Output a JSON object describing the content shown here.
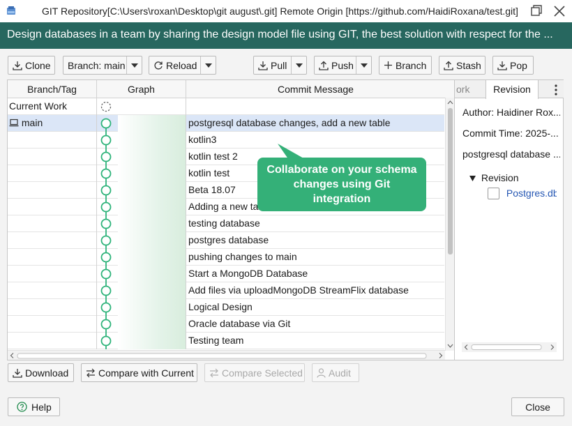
{
  "window": {
    "title": "GIT Repository[C:\\Users\\roxan\\Desktop\\git august\\.git] Remote Origin [https://github.com/HaidiRoxana/test.git]"
  },
  "banner": {
    "text": "Design databases in a team by sharing the design model file using GIT, the best solution with respect for the ..."
  },
  "toolbar": {
    "clone_label": "Clone",
    "branch_select_label": "Branch: main",
    "reload_label": "Reload",
    "pull_label": "Pull",
    "push_label": "Push",
    "new_branch_label": "Branch",
    "stash_label": "Stash",
    "pop_label": "Pop"
  },
  "table": {
    "columns": [
      "Branch/Tag",
      "Graph",
      "Commit Message"
    ],
    "current_work_label": "Current Work",
    "rows": [
      {
        "branch": "main",
        "message": "postgresql database changes, add a new table"
      },
      {
        "branch": "",
        "message": "kotlin3"
      },
      {
        "branch": "",
        "message": "kotlin test 2"
      },
      {
        "branch": "",
        "message": "kotlin test"
      },
      {
        "branch": "",
        "message": "Beta 18.07"
      },
      {
        "branch": "",
        "message": "Adding a new table"
      },
      {
        "branch": "",
        "message": "testing database"
      },
      {
        "branch": "",
        "message": "postgres database"
      },
      {
        "branch": "",
        "message": "pushing changes to main"
      },
      {
        "branch": "",
        "message": "Start a MongoDB Database"
      },
      {
        "branch": "",
        "message": "Add files via uploadMongoDB StreamFlix database"
      },
      {
        "branch": "",
        "message": "Logical Design"
      },
      {
        "branch": "",
        "message": "Oracle database via Git"
      },
      {
        "branch": "",
        "message": "Testing team"
      }
    ]
  },
  "details": {
    "tab_work_label": "ork",
    "tab_revision_label": "Revision",
    "author": "Author: Haidiner Rox...",
    "commit_time": "Commit Time: 2025-...",
    "message": "postgresql database ...",
    "tree_root_label": "Revision",
    "tree_file_label": "Postgres.dbs"
  },
  "tooltip": {
    "text": "Collaborate on your schema changes using Git integration"
  },
  "bottom_actions": {
    "download_label": "Download",
    "compare_current_label": "Compare with Current",
    "compare_selected_label": "Compare Selected",
    "audit_label": "Audit"
  },
  "footer": {
    "help_label": "Help",
    "close_label": "Close"
  },
  "colors": {
    "banner_bg": "#27675f",
    "tooltip_bg": "#34b078",
    "graph_node": "#2eb37a",
    "selected_row": "#dbe6f7"
  }
}
